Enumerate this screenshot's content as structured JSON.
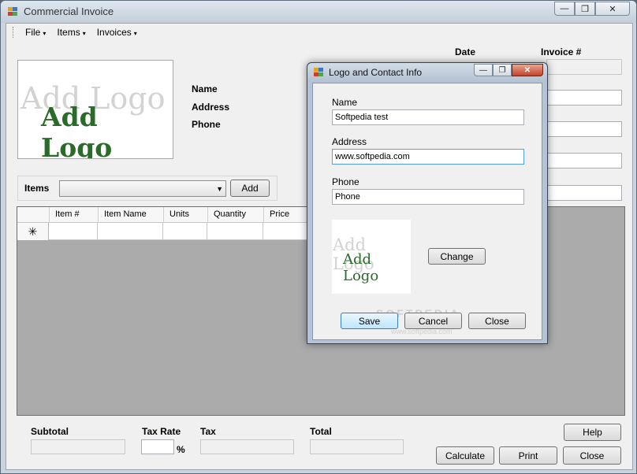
{
  "window": {
    "title": "Commercial Invoice",
    "min_glyph": "—",
    "max_glyph": "❐",
    "close_glyph": "✕"
  },
  "menu": {
    "items": [
      "File",
      "Items",
      "Invoices"
    ],
    "arrow": "▾"
  },
  "logo": {
    "shadow_text": "Add Logo",
    "main_text": "Add Logo"
  },
  "contact": {
    "name_label": "Name",
    "address_label": "Address",
    "phone_label": "Phone"
  },
  "invoice_header": {
    "date_label": "Date",
    "invoice_label": "Invoice #"
  },
  "items_bar": {
    "label": "Items",
    "add_button": "Add",
    "dropdown_arrow": "▼"
  },
  "grid": {
    "columns": [
      "Item #",
      "Item Name",
      "Units",
      "Quantity",
      "Price"
    ],
    "new_row_marker": "✳"
  },
  "totals": {
    "subtotal_label": "Subtotal",
    "tax_rate_label": "Tax Rate",
    "percent": "%",
    "tax_label": "Tax",
    "total_label": "Total"
  },
  "buttons": {
    "help": "Help",
    "calculate": "Calculate",
    "print": "Print",
    "close": "Close"
  },
  "dialog": {
    "title": "Logo and Contact Info",
    "name_label": "Name",
    "name_value": "Softpedia test",
    "address_label": "Address",
    "address_value": "www.softpedia.com",
    "phone_label": "Phone",
    "phone_value": "Phone",
    "logo_shadow": "Add Logo",
    "logo_main": "Add Logo",
    "change_button": "Change",
    "save_button": "Save",
    "cancel_button": "Cancel",
    "close_button": "Close",
    "watermark": "SOFTPEDIA",
    "watermark_url": "www.softpedia.com"
  },
  "colors": {
    "logo_green": "#2a6b2a",
    "focus_border": "#569de5",
    "grid_background": "#ababab"
  }
}
